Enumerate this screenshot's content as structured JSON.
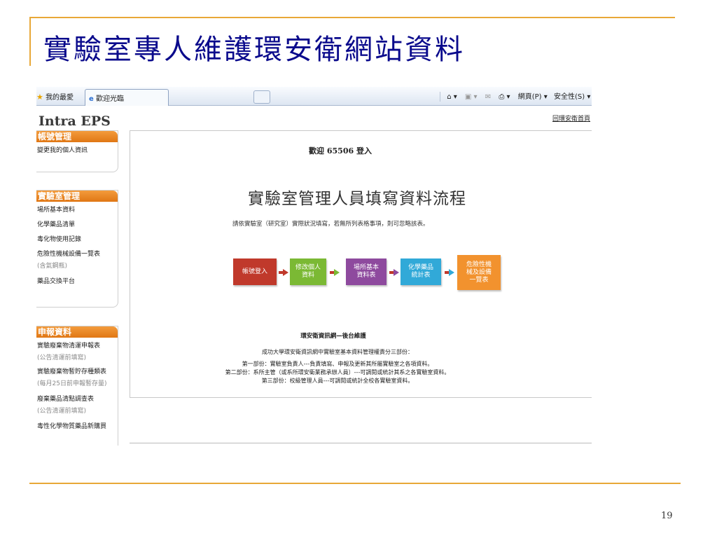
{
  "slide": {
    "title": "實驗室專人維護環安衛網站資料",
    "page_number": "19"
  },
  "browser": {
    "favorites_label": "我的最愛",
    "tab_label": "歡迎光臨",
    "toolbar": {
      "page_menu": "網頁(P)",
      "safety_menu": "安全性(S)"
    }
  },
  "app": {
    "title": "Intra EPS",
    "home_link": "回環安衛首頁"
  },
  "sidebar": {
    "account": {
      "header": "帳號管理",
      "items": [
        "變更我的個人資訊"
      ]
    },
    "lab": {
      "header": "實驗室管理",
      "items": [
        "場所基本資料",
        "化學藥品清單",
        "毒化物使用記錄",
        "危險性機械設備一覽表",
        "(含氣鋼瓶)",
        "藥品交換平台"
      ]
    },
    "report": {
      "header": "申報資料",
      "items": [
        "實驗廢棄物清運申報表",
        "(公告清運前填寫)",
        "實驗廢棄物暫貯存種類表",
        "(每月25日前申報暫存量)",
        "廢棄藥品清點調查表",
        "(公告清運前填寫)",
        "毒性化學物質藥品新購買"
      ]
    }
  },
  "main": {
    "welcome": "歡迎 65506 登入",
    "flow_title": "實驗室管理人員填寫資料流程",
    "flow_subtitle": "請依實驗室（研究室）實際狀況填寫，若無所列表格事項，則可忽略該表。",
    "steps": [
      {
        "line1": "帳號登入",
        "line2": "",
        "line3": "",
        "color": "#c0392b"
      },
      {
        "line1": "修改個人",
        "line2": "資料",
        "line3": "",
        "color": "#7bb934"
      },
      {
        "line1": "場所基本",
        "line2": "資料表",
        "line3": "",
        "color": "#8e4a9e"
      },
      {
        "line1": "化學藥品",
        "line2": "統計表",
        "line3": "",
        "color": "#31a9d8"
      },
      {
        "line1": "危險性機",
        "line2": "械及設備",
        "line3": "一覽表",
        "color": "#f2922e"
      }
    ],
    "section_title": "環安衛資訊網—後台維護",
    "section_lines": [
      "成功大學環安衛資訊網中實驗室基本資料管理權責分三部份：",
      "第一部份：實驗室負責人---負責填寫、申報及更新其所屬實驗室之各項資料。",
      "第二部份：系所主管（或系所環安衛業務承辦人員）---可調閱或統計其系之各實驗室資料。",
      "第三部份：校級管理人員---可調閱或統計全校各實驗室資料。"
    ]
  }
}
